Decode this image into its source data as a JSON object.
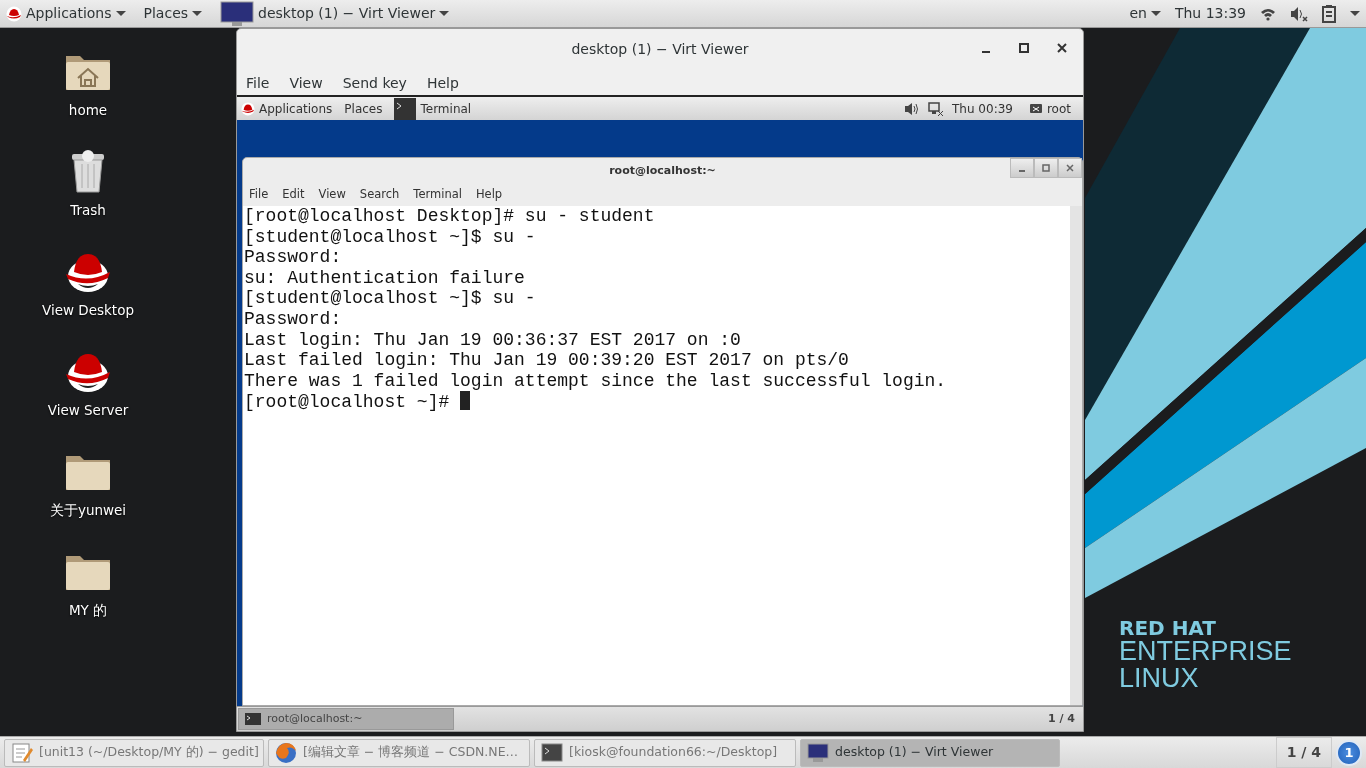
{
  "top_bar": {
    "menus": [
      {
        "label": "Applications",
        "kind": "apps"
      },
      {
        "label": "Places",
        "kind": "places"
      }
    ],
    "window_button": "desktop (1) − Virt Viewer",
    "language": "en",
    "clock": "Thu 13:39"
  },
  "desktop_icons": [
    {
      "label": "home",
      "kind": "home"
    },
    {
      "label": "Trash",
      "kind": "trash"
    },
    {
      "label": "View Desktop",
      "kind": "redhat"
    },
    {
      "label": "View Server",
      "kind": "redhat"
    },
    {
      "label": "关于yunwei",
      "kind": "folder"
    },
    {
      "label": "MY 的",
      "kind": "folder"
    }
  ],
  "branding": [
    "RED HAT",
    "ENTERPRISE",
    "LINUX"
  ],
  "virt_viewer": {
    "title": "desktop (1) − Virt Viewer",
    "menu": [
      "File",
      "View",
      "Send key",
      "Help"
    ],
    "guest": {
      "top_bar": {
        "menus": [
          "Applications",
          "Places"
        ],
        "task": "Terminal",
        "clock": "Thu 00:39",
        "user": "root"
      },
      "terminal": {
        "title": "root@localhost:~",
        "menu": [
          "File",
          "Edit",
          "View",
          "Search",
          "Terminal",
          "Help"
        ],
        "lines": [
          "[root@localhost Desktop]# su - student",
          "[student@localhost ~]$ su -",
          "Password:",
          "su: Authentication failure",
          "[student@localhost ~]$ su -",
          "Password:",
          "Last login: Thu Jan 19 00:36:37 EST 2017 on :0",
          "Last failed login: Thu Jan 19 00:39:20 EST 2017 on pts/0",
          "There was 1 failed login attempt since the last successful login.",
          "[root@localhost ~]# "
        ],
        "cursor_visible": true
      },
      "bottom_bar": {
        "task": "root@localhost:~",
        "pager": "1 / 4"
      }
    }
  },
  "taskbar": {
    "tasks": [
      {
        "label": "[unit13 (~/Desktop/MY 的) − gedit]",
        "kind": "gedit",
        "selected": false
      },
      {
        "label": "[编辑文章 − 博客频道 − CSDN.NE…",
        "kind": "firefox",
        "selected": false
      },
      {
        "label": "[kiosk@foundation66:~/Desktop]",
        "kind": "terminal",
        "selected": false
      },
      {
        "label": "desktop (1) − Virt Viewer",
        "kind": "viewer",
        "selected": true
      }
    ],
    "pager": "1 / 4",
    "notifications": "1"
  }
}
